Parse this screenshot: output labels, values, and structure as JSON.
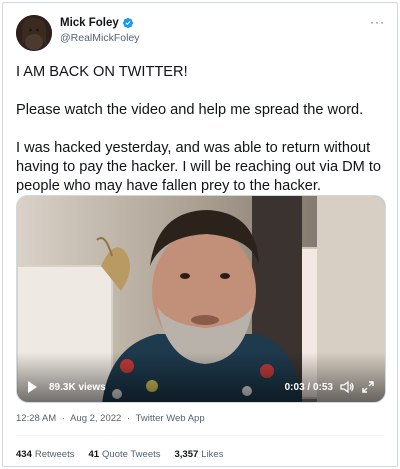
{
  "tweet": {
    "author": {
      "display_name": "Mick Foley",
      "handle": "@RealMickFoley",
      "verified_icon": "verified-badge-icon",
      "verified_color": "#1d9bf0"
    },
    "more_icon": "more-options-icon",
    "more_label": "···",
    "text": {
      "line1": "I AM BACK ON TWITTER!",
      "line2": "Please watch the video and help me spread the word.",
      "line3": "I was hacked yesterday, and was able to return without having to pay the hacker. I will be reaching out via DM to people who may have fallen prey to the hacker."
    },
    "video": {
      "views": "89.3K views",
      "time": "0:03 / 0:53",
      "play_icon": "play-icon",
      "volume_icon": "volume-icon",
      "fullscreen_icon": "fullscreen-icon"
    },
    "meta": {
      "time": "12:28 AM",
      "date": "Aug 2, 2022",
      "source": "Twitter Web App",
      "separator": "·"
    },
    "stats": {
      "retweets_count": "434",
      "retweets_label": "Retweets",
      "quotes_count": "41",
      "quotes_label": "Quote Tweets",
      "likes_count": "3,357",
      "likes_label": "Likes"
    }
  }
}
